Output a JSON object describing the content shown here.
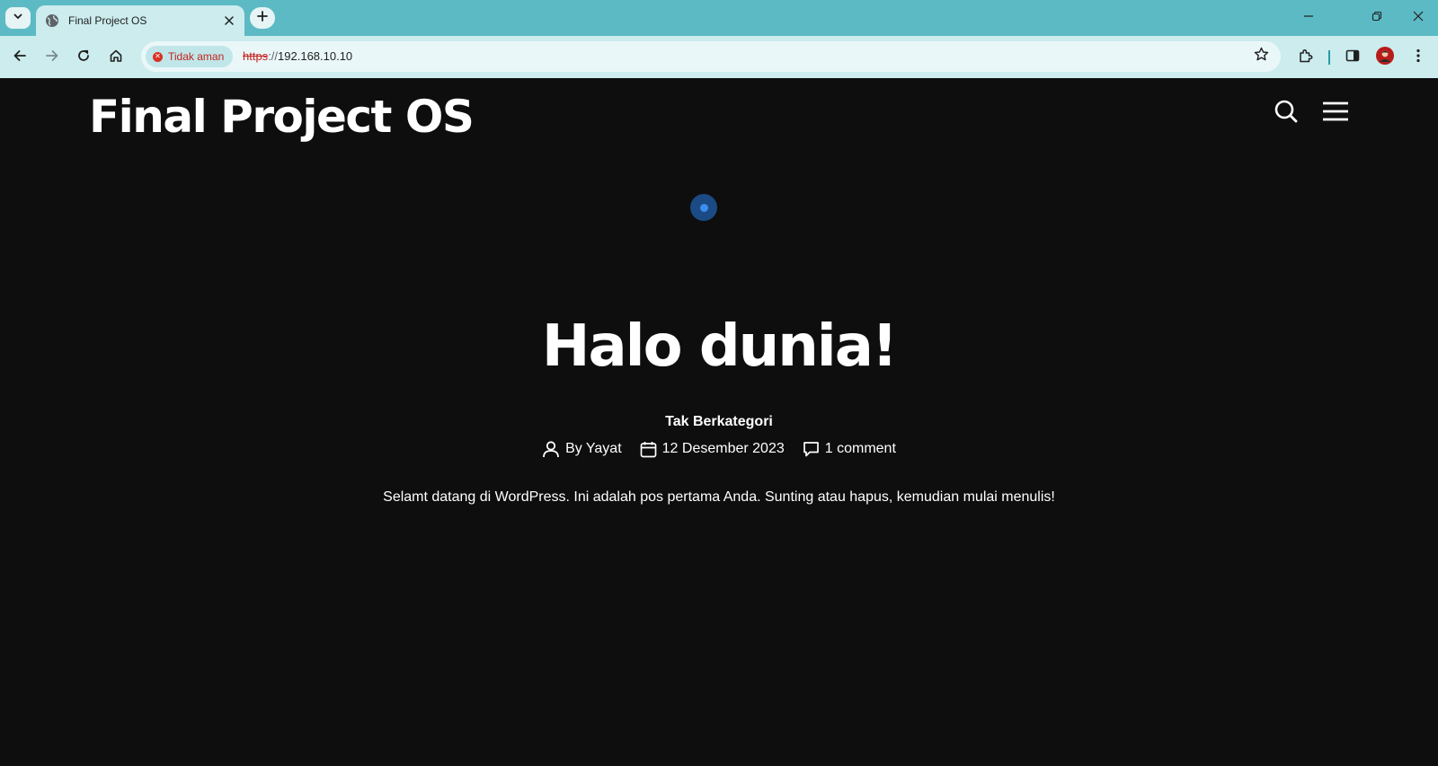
{
  "browser": {
    "tab": {
      "title": "Final Project OS"
    },
    "security_label": "Tidak aman",
    "url": {
      "scheme": "https",
      "separator": "://",
      "host": "192.168.10.10"
    }
  },
  "site": {
    "title": "Final Project OS"
  },
  "post": {
    "title": "Halo dunia!",
    "category": "Tak Berkategori",
    "author": "By Yayat",
    "date": "12 Desember 2023",
    "comments": "1 comment",
    "excerpt": "Selamt datang di WordPress. Ini adalah pos pertama Anda. Sunting atau hapus, kemudian mulai menulis!"
  },
  "colors": {
    "tabstrip": "#5cbac4",
    "toolbar": "#ccecee",
    "page_background": "#0e0e0f",
    "insecure_red": "#c5221f",
    "loader": "#3b8ef0"
  },
  "icons": [
    "tab-search-icon",
    "globe-icon",
    "close-icon",
    "plus-icon",
    "minimize-icon",
    "restore-icon",
    "window-close-icon",
    "back-arrow-icon",
    "forward-arrow-icon",
    "reload-icon",
    "home-icon",
    "warning-icon",
    "star-icon",
    "extensions-icon",
    "side-panel-icon",
    "avatar",
    "kebab-menu-icon",
    "search-icon",
    "hamburger-menu-icon",
    "user-icon",
    "calendar-icon",
    "comment-icon"
  ]
}
